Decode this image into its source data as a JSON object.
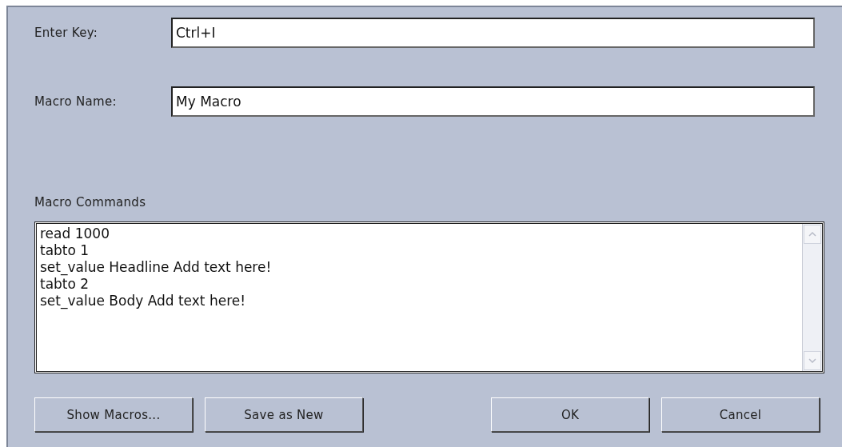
{
  "fields": [
    {
      "label": "Enter Key:",
      "value": "Ctrl+I"
    },
    {
      "label": "Macro Name:",
      "value": "My Macro"
    }
  ],
  "commands": {
    "label": "Macro Commands",
    "lines": [
      "read 1000",
      "tabto 1",
      "set_value Headline Add text here!",
      "tabto 2",
      "set_value Body Add text here!"
    ]
  },
  "buttons": [
    {
      "label": "Show Macros...",
      "kind": "left"
    },
    {
      "label": "Save as New",
      "kind": "left"
    },
    {
      "label": "OK",
      "kind": "right"
    },
    {
      "label": "Cancel",
      "kind": "right"
    }
  ]
}
